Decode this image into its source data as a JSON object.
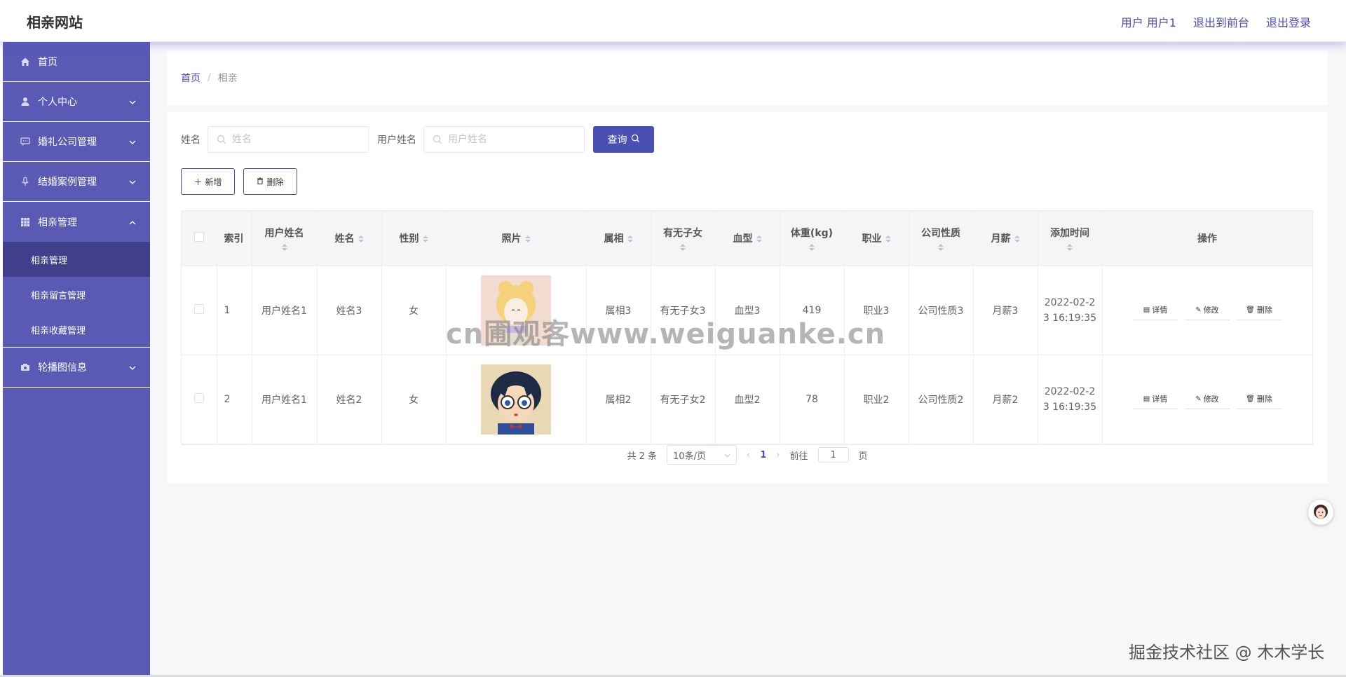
{
  "app": {
    "title": "相亲网站"
  },
  "topbar": {
    "user_label": "用户 用户1",
    "front_label": "退出到前台",
    "logout_label": "退出登录"
  },
  "sidebar": {
    "items": [
      {
        "label": "首页",
        "icon": "home-icon"
      },
      {
        "label": "个人中心",
        "icon": "user-icon"
      },
      {
        "label": "婚礼公司管理",
        "icon": "chat-icon"
      },
      {
        "label": "结婚案例管理",
        "icon": "mic-icon"
      },
      {
        "label": "相亲管理",
        "icon": "grid-icon"
      },
      {
        "label": "轮播图信息",
        "icon": "camera-icon"
      }
    ],
    "sub_items": [
      "相亲管理",
      "相亲留言管理",
      "相亲收藏管理"
    ]
  },
  "breadcrumb": {
    "home": "首页",
    "sep": "/",
    "current": "相亲"
  },
  "search": {
    "name_label": "姓名",
    "name_placeholder": "姓名",
    "username_label": "用户姓名",
    "username_placeholder": "用户姓名",
    "query_label": "查询"
  },
  "actions": {
    "add_label": "新增",
    "delete_label": "删除"
  },
  "table": {
    "headers": [
      "索引",
      "用户姓名",
      "姓名",
      "性别",
      "照片",
      "属相",
      "有无子女",
      "血型",
      "体重(kg)",
      "职业",
      "公司性质",
      "月薪",
      "添加时间",
      "操作"
    ],
    "rows": [
      {
        "index": "1",
        "username": "用户姓名1",
        "name": "姓名3",
        "gender": "女",
        "zodiac": "属相3",
        "children": "有无子女3",
        "blood": "血型3",
        "weight": "419",
        "job": "职业3",
        "company": "公司性质3",
        "salary": "月薪3",
        "time": "2022-02-23 16:19:35"
      },
      {
        "index": "2",
        "username": "用户姓名1",
        "name": "姓名2",
        "gender": "女",
        "zodiac": "属相2",
        "children": "有无子女2",
        "blood": "血型2",
        "weight": "78",
        "job": "职业2",
        "company": "公司性质2",
        "salary": "月薪2",
        "time": "2022-02-23 16:19:35"
      }
    ],
    "op_labels": {
      "detail": "详情",
      "edit": "修改",
      "delete": "删除"
    }
  },
  "pagination": {
    "total": "共 2 条",
    "page_size": "10条/页",
    "current_page": "1",
    "goto_label": "前往",
    "goto_value": "1",
    "page_suffix": "页"
  },
  "watermarks": {
    "center": "cn圃观客www.weiguanke.cn",
    "corner": "掘金技术社区 @ 木木学长"
  },
  "colors": {
    "accent": "#4a4fb3",
    "sidebar": "#5a5ab4",
    "sidebar_active": "#3f3f8c"
  }
}
